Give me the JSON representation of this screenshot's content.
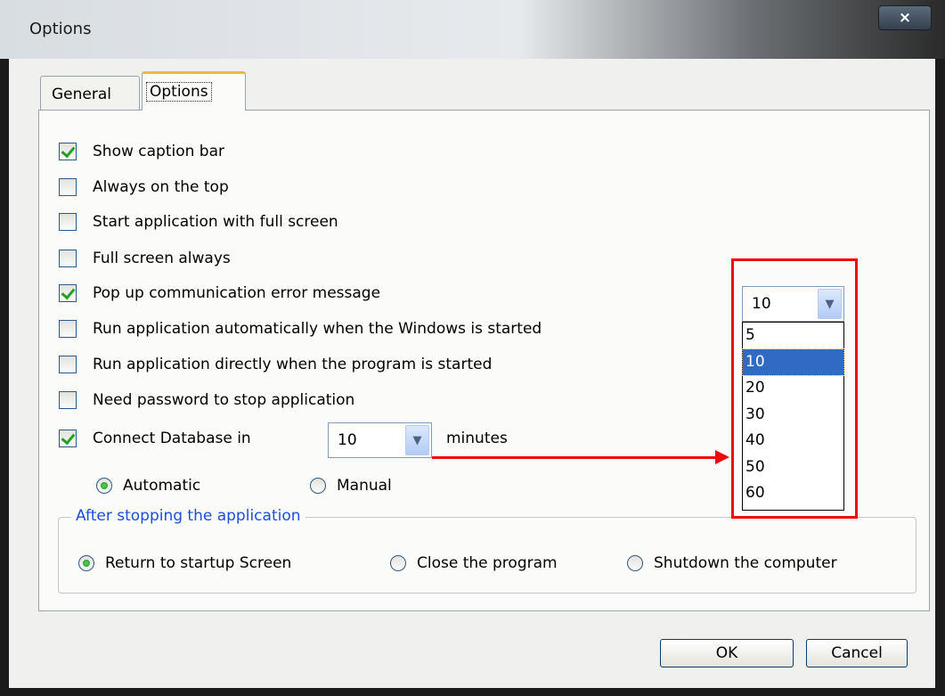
{
  "window": {
    "title": "Options",
    "close_label": "×"
  },
  "tabs": [
    {
      "label": "General"
    },
    {
      "label": "Options"
    }
  ],
  "options": [
    {
      "label": "Show caption bar",
      "checked": true
    },
    {
      "label": "Always on the top",
      "checked": false
    },
    {
      "label": "Start application with full screen",
      "checked": false
    },
    {
      "label": "Full screen always",
      "checked": false
    },
    {
      "label": "Pop up communication error message",
      "checked": true
    },
    {
      "label": "Run application automatically when the Windows is started",
      "checked": false
    },
    {
      "label": "Run application directly when the program is started",
      "checked": false
    },
    {
      "label": "Need password to stop application",
      "checked": false
    },
    {
      "label": "Connect Database in",
      "checked": true
    }
  ],
  "connect": {
    "value": "10",
    "unit": "minutes"
  },
  "connect_mode": {
    "automatic": "Automatic",
    "manual": "Manual",
    "selected": "Automatic"
  },
  "after_stop": {
    "title": "After stopping the application",
    "options": [
      "Return to startup Screen",
      "Close the program",
      "Shutdown the computer"
    ],
    "selected": "Return to startup Screen"
  },
  "dropdown": {
    "value": "10",
    "items": [
      "5",
      "10",
      "20",
      "30",
      "40",
      "50",
      "60"
    ],
    "selected": "10"
  },
  "buttons": {
    "ok": "OK",
    "cancel": "Cancel"
  },
  "icons": {
    "dropdown_arrow": "chevron-down-icon"
  },
  "colors": {
    "highlight": "#ee0a0a",
    "selection": "#316ac5",
    "group_title": "#1b4fdb",
    "tab_accent": "#f7b540"
  }
}
